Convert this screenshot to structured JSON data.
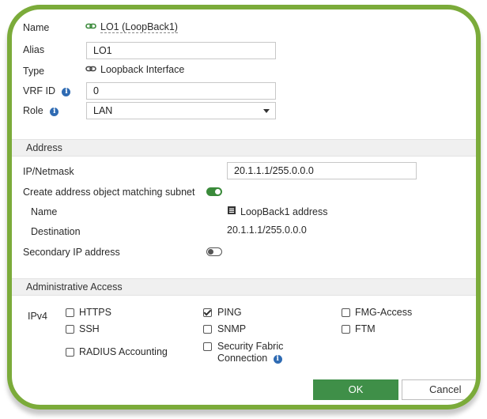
{
  "form": {
    "name_label": "Name",
    "name_value": "LO1 (LoopBack1)",
    "alias_label": "Alias",
    "alias_value": "LO1",
    "type_label": "Type",
    "type_value": "Loopback Interface",
    "vrf_label": "VRF ID",
    "vrf_value": "0",
    "role_label": "Role",
    "role_value": "LAN"
  },
  "address": {
    "header": "Address",
    "ip_label": "IP/Netmask",
    "ip_value": "20.1.1.1/255.0.0.0",
    "create_object_label": "Create address object matching subnet",
    "create_object_enabled": true,
    "obj_name_label": "Name",
    "obj_name_value": "LoopBack1 address",
    "destination_label": "Destination",
    "destination_value": "20.1.1.1/255.0.0.0",
    "secondary_label": "Secondary IP address",
    "secondary_enabled": false
  },
  "admin_access": {
    "header": "Administrative Access",
    "ipv4_label": "IPv4",
    "options": {
      "https": {
        "label": "HTTPS",
        "checked": false
      },
      "ping": {
        "label": "PING",
        "checked": true
      },
      "fmg": {
        "label": "FMG-Access",
        "checked": false
      },
      "ssh": {
        "label": "SSH",
        "checked": false
      },
      "snmp": {
        "label": "SNMP",
        "checked": false
      },
      "ftm": {
        "label": "FTM",
        "checked": false
      },
      "radius": {
        "label": "RADIUS Accounting",
        "checked": false
      },
      "fabric_line1": {
        "label": "Security Fabric",
        "checked": false
      },
      "fabric_line2": "Connection"
    }
  },
  "buttons": {
    "ok": "OK",
    "cancel": "Cancel"
  },
  "colors": {
    "frame": "#7bab3a",
    "ok_button": "#3f8f48",
    "toggle_on": "#3a8a3a",
    "info_icon": "#2f6bb3"
  },
  "icons": [
    "link-icon",
    "info-icon",
    "dropdown-arrow-icon",
    "address-object-icon",
    "toggle-switch"
  ]
}
